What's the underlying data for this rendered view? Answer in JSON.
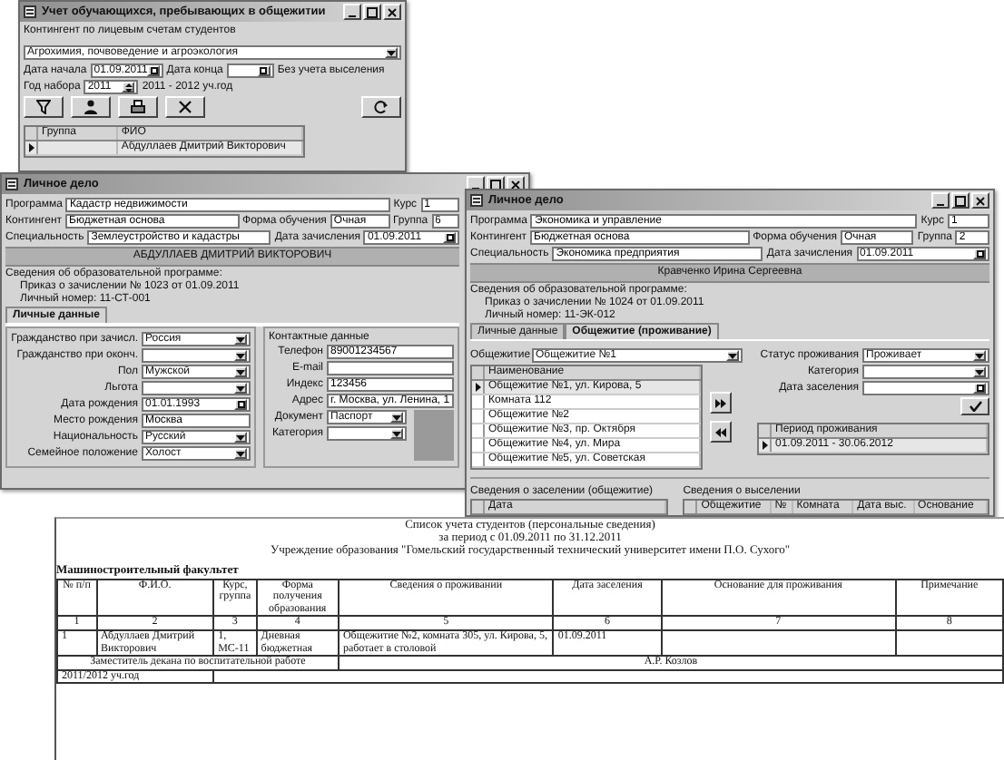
{
  "enrollment_window": {
    "title": "Учет обучающихся, пребывающих в общежитии",
    "filter_label": "Контингент по лицевым счетам студентов",
    "program": "Агрохимия, почвоведение и агроэкология",
    "period": {
      "start_label": "Дата начала",
      "start": "01.09.2011",
      "end_label": "Дата конца",
      "note": "Без учета выселения"
    },
    "intake": {
      "label": "Год набора",
      "year": "2011",
      "academic_year": "2011 - 2012 уч.год"
    },
    "toolbar": [
      {
        "kind": "filter"
      },
      {
        "kind": "person"
      },
      {
        "kind": "print"
      },
      {
        "kind": "cross"
      },
      {
        "kind": "refresh"
      }
    ],
    "grid": {
      "columns": [
        "Группа",
        "ФИО"
      ],
      "rows": [
        {
          "cells": [
            null,
            "Абдуллаев Дмитрий Викторович"
          ],
          "selected": true
        }
      ]
    }
  },
  "student_window": {
    "title": "Личное дело",
    "header_rows": [
      [
        {
          "kind": "label",
          "text": "Программа"
        },
        {
          "kind": "field",
          "value": "Кадастр недвижимости"
        },
        {
          "kind": "label",
          "text": "Курс"
        },
        {
          "kind": "field",
          "value": "1"
        }
      ],
      [
        {
          "kind": "label",
          "text": "Контингент"
        },
        {
          "kind": "field",
          "value": "Бюджетная основа"
        },
        {
          "kind": "label",
          "text": "Форма обучения"
        },
        {
          "kind": "field",
          "value": "Очная"
        },
        {
          "kind": "label",
          "text": "Группа"
        },
        {
          "kind": "field",
          "value": "6"
        }
      ],
      [
        {
          "kind": "label",
          "text": "Специальность"
        },
        {
          "kind": "field",
          "value": "Землеустройство и кадастры"
        },
        {
          "kind": "label",
          "text": "Дата зачисления"
        },
        {
          "kind": "date",
          "value": "01.09.2011"
        }
      ]
    ],
    "banner": "АБДУЛЛАЕВ ДМИТРИЙ ВИКТОРОВИЧ",
    "info_lines": [
      "Сведения об образовательной программе:",
      "Приказ о зачислении № 1023 от 01.09.2011",
      "Личный номер: 11-СТ-001"
    ],
    "tabs": [
      {
        "label": "Личные данные",
        "selected": true
      }
    ],
    "left_fields": [
      {
        "kind": "combo",
        "label": "Гражданство при зачисл.",
        "value": "Россия"
      },
      {
        "kind": "combo",
        "label": "Гражданство при оконч."
      },
      {
        "kind": "combo",
        "label": "Пол",
        "value": "Мужской"
      },
      {
        "kind": "combo",
        "label": "Льгота"
      },
      {
        "kind": "date",
        "label": "Дата рождения",
        "value": "01.01.1993"
      },
      {
        "kind": "field",
        "label": "Место рождения",
        "value": "Москва"
      },
      {
        "kind": "combo",
        "label": "Национальность",
        "value": "Русский"
      },
      {
        "kind": "combo",
        "label": "Семейное положение",
        "value": "Холост"
      }
    ],
    "contacts": {
      "title": "Контактные данные",
      "fields": [
        {
          "kind": "field",
          "label": "Телефон",
          "value": "89001234567"
        },
        {
          "kind": "field",
          "label": "E-mail"
        },
        {
          "kind": "field",
          "label": "Индекс",
          "value": "123456"
        },
        {
          "kind": "field",
          "label": "Адрес",
          "value": "г. Москва, ул. Ленина, 1"
        },
        {
          "kind": "combo",
          "label": "Документ",
          "value": "Паспорт"
        },
        {
          "kind": "combo",
          "label": "Категория"
        }
      ]
    }
  },
  "dormitory_window": {
    "title": "Личное дело",
    "header_rows": [
      [
        {
          "kind": "label",
          "text": "Программа"
        },
        {
          "kind": "field",
          "value": "Экономика и управление"
        },
        {
          "kind": "label",
          "text": "Курс"
        },
        {
          "kind": "field",
          "value": "1"
        }
      ],
      [
        {
          "kind": "label",
          "text": "Контингент"
        },
        {
          "kind": "field",
          "value": "Бюджетная основа"
        },
        {
          "kind": "label",
          "text": "Форма обучения"
        },
        {
          "kind": "field",
          "value": "Очная"
        },
        {
          "kind": "label",
          "text": "Группа"
        },
        {
          "kind": "field",
          "value": "2"
        }
      ],
      [
        {
          "kind": "label",
          "text": "Специальность"
        },
        {
          "kind": "field",
          "value": "Экономика предприятия"
        },
        {
          "kind": "label",
          "text": "Дата зачисления"
        },
        {
          "kind": "date",
          "value": "01.09.2011"
        }
      ]
    ],
    "banner": "Кравченко Ирина Сергеевна",
    "info_lines": [
      "Сведения об образовательной программе:",
      "Приказ о зачислении № 1024 от 01.09.2011",
      "Личный номер: 11-ЭК-012"
    ],
    "tabs": [
      {
        "label": "Личные данные",
        "selected": false
      },
      {
        "label": "Общежитие (проживание)",
        "selected": true
      }
    ],
    "left_fields": [
      {
        "kind": "combo",
        "label": "Общежитие",
        "value": "Общежитие №1"
      }
    ],
    "right_fields": [
      {
        "kind": "combo",
        "label": "Статус проживания",
        "value": "Проживает"
      },
      {
        "kind": "combo",
        "label": "Категория"
      },
      {
        "kind": "date",
        "label": "Дата заселения"
      }
    ],
    "rooms": {
      "columns": [
        "Наименование"
      ],
      "rows": [
        {
          "cells": [
            "Общежитие №1, ул. Кирова, 5"
          ],
          "selected": true
        },
        {
          "cells": [
            "Комната 112"
          ],
          "selected": false
        },
        {
          "cells": [
            "Общежитие №2"
          ],
          "selected": false
        },
        {
          "cells": [
            "Общежитие №3, пр. Октября"
          ],
          "selected": false
        },
        {
          "cells": [
            "Общежитие №4, ул. Мира"
          ],
          "selected": false
        },
        {
          "cells": [
            "Общежитие №5, ул. Советская"
          ],
          "selected": false
        }
      ]
    },
    "move_buttons": [
      {
        "kind": "add"
      },
      {
        "kind": "remove"
      }
    ],
    "period": {
      "columns": [
        "Период проживания"
      ],
      "rows": [
        {
          "cells": [
            "01.09.2011 - 30.06.2012"
          ],
          "selected": true
        }
      ]
    },
    "checkin": {
      "title": "Сведения о заселении (общежитие)",
      "columns": [
        "Дата"
      ]
    },
    "checkout": {
      "title": "Сведения о выселении",
      "columns": [
        "Общежитие",
        "№",
        "Комната",
        "Дата выс.",
        "Основание"
      ]
    }
  },
  "report": {
    "title": "Список учета студентов (персональные сведения)",
    "period": "за период с 01.09.2011 по 31.12.2011",
    "organization": "Учреждение образования \"Гомельский государственный технический университет имени П.О. Сухого\"",
    "faculty": "Машиностроительный факультет",
    "columns": [
      "№ п/п",
      "Ф.И.О.",
      "Курс, группа",
      "Форма получения образования",
      "Сведения о проживании",
      "Дата заселения",
      "Основание для проживания",
      "Примечание"
    ],
    "column_numbers": [
      "1",
      "2",
      "3",
      "4",
      "5",
      "6",
      "7",
      "8"
    ],
    "rows": [
      {
        "number": "1",
        "name": "Абдуллаев Дмитрий Викторович",
        "group": "1, МС-11",
        "form": "Дневная бюджетная",
        "residence": "Общежитие №2, комната 305, ул. Кирова, 5, работает в столовой",
        "date": "01.09.2011"
      }
    ],
    "signature": {
      "position": "Заместитель декана по воспитательной работе",
      "name": "А.Р. Козлов"
    },
    "year": "2011/2012 уч.год"
  }
}
